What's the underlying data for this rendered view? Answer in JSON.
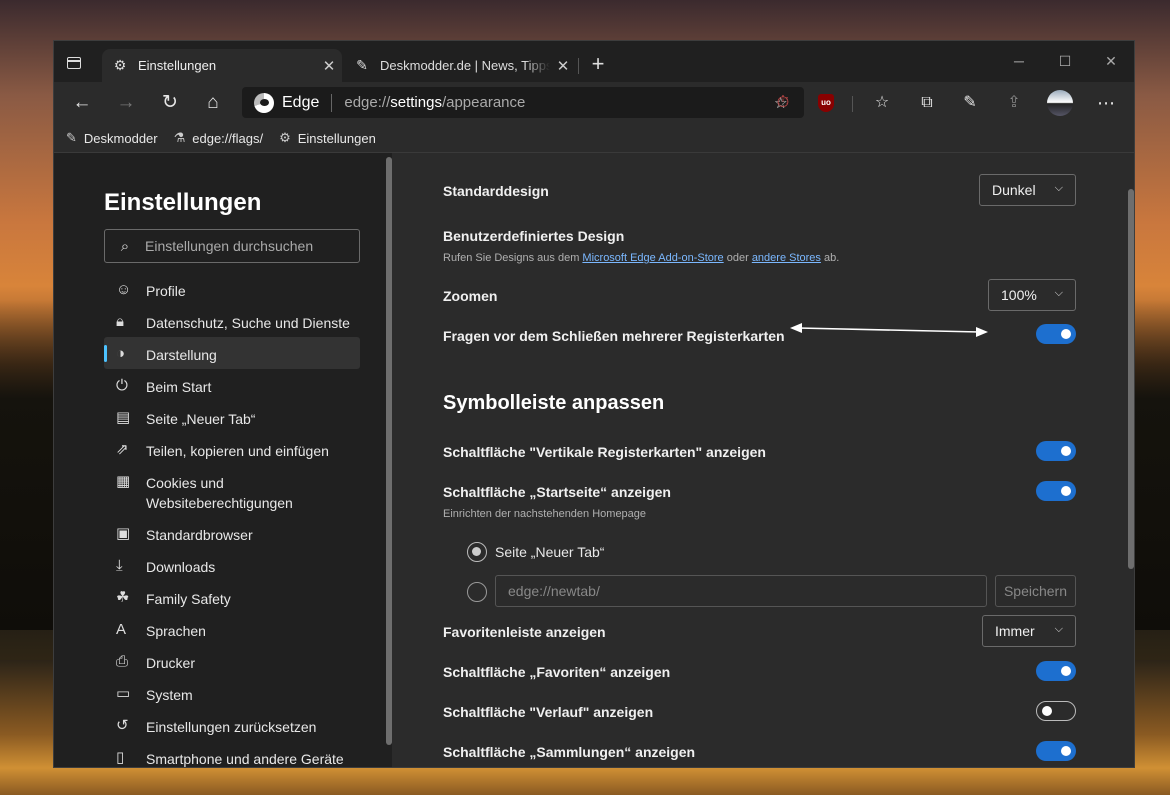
{
  "browser": {
    "tabs": [
      {
        "title": "Einstellungen",
        "icon": "gear-icon",
        "active": true
      },
      {
        "title": "Deskmodder.de | News, Tipps und",
        "icon": "deskmodder-icon",
        "active": false
      }
    ],
    "omnibox": {
      "brand": "Edge",
      "url_prefix": "edge://",
      "url_host": "settings",
      "url_path": "/appearance"
    },
    "bookmarks": [
      {
        "label": "Deskmodder",
        "icon": "pen-icon"
      },
      {
        "label": "edge://flags/",
        "icon": "flask-icon"
      },
      {
        "label": "Einstellungen",
        "icon": "gear-icon"
      }
    ]
  },
  "sidebar": {
    "title": "Einstellungen",
    "search_placeholder": "Einstellungen durchsuchen",
    "items": [
      {
        "label": "Profile",
        "icon": "profile-icon"
      },
      {
        "label": "Datenschutz, Suche und Dienste",
        "icon": "lock-icon"
      },
      {
        "label": "Darstellung",
        "icon": "palette-icon",
        "selected": true
      },
      {
        "label": "Beim Start",
        "icon": "power-icon"
      },
      {
        "label": "Seite „Neuer Tab“",
        "icon": "newtab-icon"
      },
      {
        "label": "Teilen, kopieren und einfügen",
        "icon": "share-icon"
      },
      {
        "label": "Cookies und",
        "label2": "Websiteberechtigungen",
        "icon": "cookies-icon"
      },
      {
        "label": "Standardbrowser",
        "icon": "browser-icon"
      },
      {
        "label": "Downloads",
        "icon": "download-icon"
      },
      {
        "label": "Family Safety",
        "icon": "family-icon"
      },
      {
        "label": "Sprachen",
        "icon": "language-icon"
      },
      {
        "label": "Drucker",
        "icon": "printer-icon"
      },
      {
        "label": "System",
        "icon": "laptop-icon"
      },
      {
        "label": "Einstellungen zurücksetzen",
        "icon": "reset-icon"
      },
      {
        "label": "Smartphone und andere Geräte",
        "icon": "phone-icon"
      }
    ]
  },
  "main": {
    "standarddesign": {
      "label": "Standarddesign",
      "value": "Dunkel"
    },
    "custom_design": {
      "label": "Benutzerdefiniertes Design",
      "desc_pre": "Rufen Sie Designs aus dem ",
      "link1": "Microsoft Edge Add-on-Store",
      "desc_mid": " oder ",
      "link2": "andere Stores",
      "desc_post": " ab."
    },
    "zoom": {
      "label": "Zoomen",
      "value": "100%"
    },
    "ask_close": {
      "label": "Fragen vor dem Schließen mehrerer Registerkarten",
      "on": true
    },
    "section_toolbar": "Symbolleiste anpassen",
    "vertical_tabs": {
      "label": "Schaltfläche \"Vertikale Registerkarten\" anzeigen",
      "on": true
    },
    "home_button": {
      "label": "Schaltfläche „Startseite“ anzeigen",
      "desc": "Einrichten der nachstehenden Homepage",
      "on": true
    },
    "home_options": {
      "radio1": "Seite „Neuer Tab“",
      "url_placeholder": "edge://newtab/",
      "save": "Speichern"
    },
    "favbar": {
      "label": "Favoritenleiste anzeigen",
      "value": "Immer"
    },
    "fav_button": {
      "label": "Schaltfläche „Favoriten“ anzeigen",
      "on": true
    },
    "history_button": {
      "label": "Schaltfläche \"Verlauf\" anzeigen",
      "on": false
    },
    "collections_button": {
      "label": "Schaltfläche „Sammlungen“ anzeigen",
      "on": true
    }
  }
}
